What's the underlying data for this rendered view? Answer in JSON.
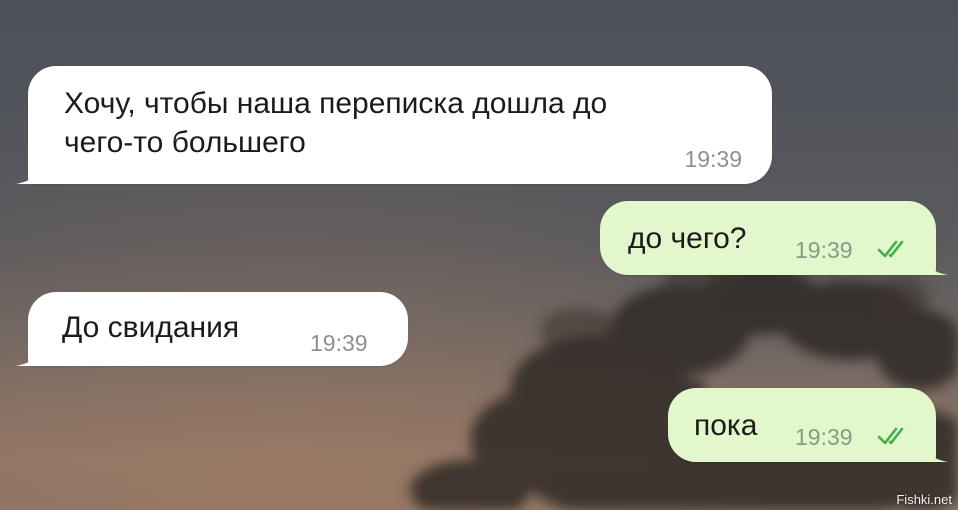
{
  "chat": {
    "wallpaper": "dusk-sky-with-trees",
    "colors": {
      "incoming_bubble": "#ffffff",
      "outgoing_bubble": "#e2f7cb",
      "read_check": "#3fb24a",
      "timestamp": "#909090"
    },
    "messages": [
      {
        "direction": "incoming",
        "lines": [
          "Хочу, чтобы наша переписка дошла до",
          "чего-то большего"
        ],
        "time": "19:39"
      },
      {
        "direction": "outgoing",
        "text": "до чего?",
        "time": "19:39",
        "status": "read"
      },
      {
        "direction": "incoming",
        "text": "До свидания",
        "time": "19:39"
      },
      {
        "direction": "outgoing",
        "text": "пока",
        "time": "19:39",
        "status": "read"
      }
    ]
  },
  "watermark": "Fishki.net"
}
